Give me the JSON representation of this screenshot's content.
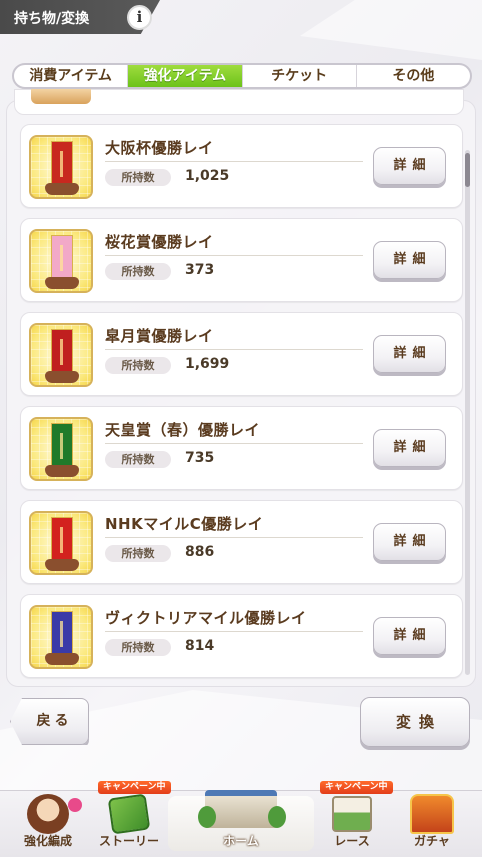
{
  "header": {
    "title": "持ち物/変換",
    "info_label": "i"
  },
  "tabs": [
    {
      "label": "消費アイテム",
      "active": false
    },
    {
      "label": "強化アイテム",
      "active": true
    },
    {
      "label": "チケット",
      "active": false
    },
    {
      "label": "その他",
      "active": false
    }
  ],
  "items": [
    {
      "name": "大阪杯優勝レイ",
      "qty_label": "所持数",
      "qty": "1,025",
      "detail_label": "詳細",
      "band_color": "#c8281f"
    },
    {
      "name": "桜花賞優勝レイ",
      "qty_label": "所持数",
      "qty": "373",
      "detail_label": "詳細",
      "band_color": "#f2a9c8"
    },
    {
      "name": "皐月賞優勝レイ",
      "qty_label": "所持数",
      "qty": "1,699",
      "detail_label": "詳細",
      "band_color": "#c01f1f"
    },
    {
      "name": "天皇賞（春）優勝レイ",
      "qty_label": "所持数",
      "qty": "735",
      "detail_label": "詳細",
      "band_color": "#1f7a2a"
    },
    {
      "name": "NHKマイルC優勝レイ",
      "qty_label": "所持数",
      "qty": "886",
      "detail_label": "詳細",
      "band_color": "#d3221e"
    },
    {
      "name": "ヴィクトリアマイル優勝レイ",
      "qty_label": "所持数",
      "qty": "814",
      "detail_label": "詳細",
      "band_color": "#3a3aa8"
    }
  ],
  "buttons": {
    "back": "戻る",
    "convert": "変換"
  },
  "nav": {
    "items": [
      {
        "label": "強化編成",
        "icon": "horse-girl-icon"
      },
      {
        "label": "ストーリー",
        "icon": "story-book-icon",
        "badge": "キャンペーン中"
      },
      {
        "label": "ホーム",
        "icon": "school-building-icon"
      },
      {
        "label": "レース",
        "icon": "racetrack-icon",
        "badge": "キャンペーン中"
      },
      {
        "label": "ガチャ",
        "icon": "gacha-gate-icon"
      }
    ]
  },
  "colors": {
    "active_tab": "#7ccd24",
    "text_brown": "#5a3b1f",
    "campaign_badge": "#e8451f"
  }
}
